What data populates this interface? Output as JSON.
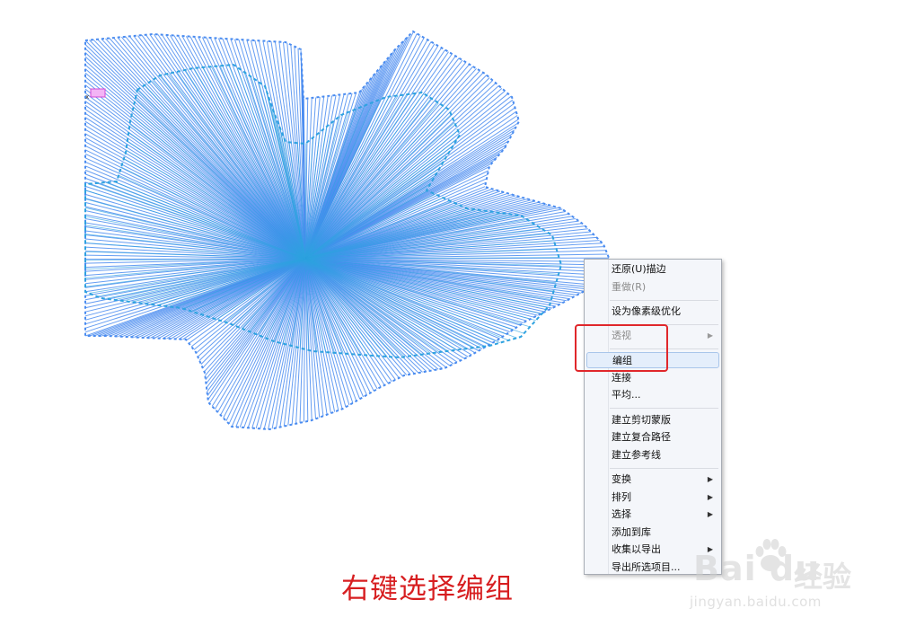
{
  "menu": {
    "items": [
      {
        "label": "还原(U)描边",
        "disabled": false,
        "submenu": false
      },
      {
        "label": "重做(R)",
        "disabled": true,
        "submenu": false
      },
      {
        "separator": true
      },
      {
        "label": "设为像素级优化",
        "disabled": false,
        "submenu": false
      },
      {
        "separator": true
      },
      {
        "label": "透视",
        "disabled": true,
        "submenu": true
      },
      {
        "separator": true
      },
      {
        "label": "编组",
        "disabled": false,
        "submenu": false,
        "highlighted": true
      },
      {
        "label": "连接",
        "disabled": false,
        "submenu": false
      },
      {
        "label": "平均...",
        "disabled": false,
        "submenu": false
      },
      {
        "separator": true
      },
      {
        "label": "建立剪切蒙版",
        "disabled": false,
        "submenu": false
      },
      {
        "label": "建立复合路径",
        "disabled": false,
        "submenu": false
      },
      {
        "label": "建立参考线",
        "disabled": false,
        "submenu": false
      },
      {
        "separator": true
      },
      {
        "label": "变换",
        "disabled": false,
        "submenu": true
      },
      {
        "label": "排列",
        "disabled": false,
        "submenu": true
      },
      {
        "label": "选择",
        "disabled": false,
        "submenu": true
      },
      {
        "label": "添加到库",
        "disabled": false,
        "submenu": false
      },
      {
        "label": "收集以导出",
        "disabled": false,
        "submenu": true
      },
      {
        "label": "导出所选项目...",
        "disabled": false,
        "submenu": false
      }
    ]
  },
  "caption": "右键选择编组",
  "watermark": {
    "brand": "Bai du",
    "jingyan": "经验",
    "url": "jingyan.baidu.com"
  },
  "colors": {
    "outer_lines": "#4a8cf0",
    "inner_dashed": "#2ea2e0",
    "highlight_box": "#e0272b",
    "caption": "#d71e20",
    "menu_bg": "#f4f6fa"
  },
  "icons": {
    "submenu_arrow": "▶"
  }
}
